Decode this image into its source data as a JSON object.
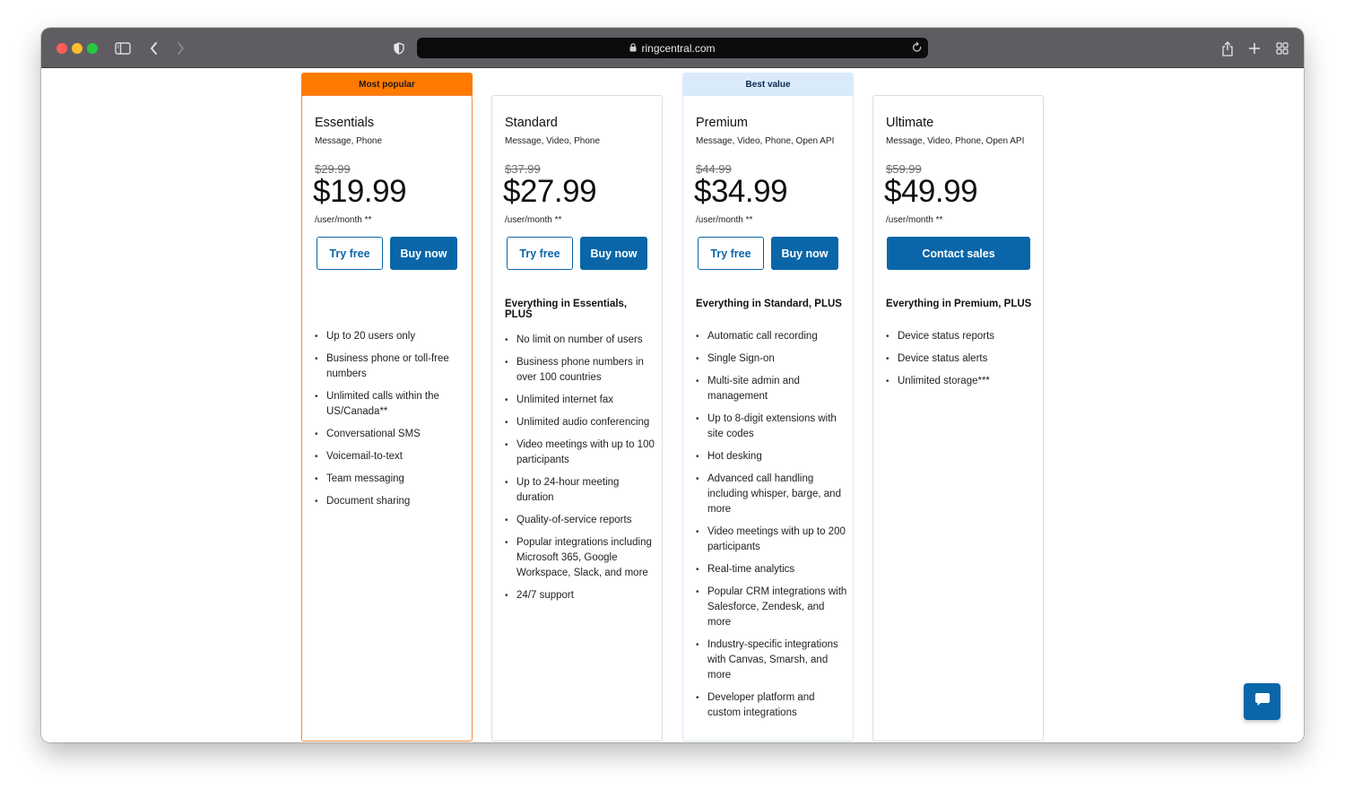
{
  "browser": {
    "url": "ringcentral.com",
    "icons": {
      "sidebar": "sidebar-icon",
      "back": "chevron-left-icon",
      "forward": "chevron-right-icon",
      "privacy": "shield-icon",
      "lock": "lock-icon",
      "reload": "reload-icon",
      "share": "share-icon",
      "new_tab": "plus-icon",
      "tabs": "tab-grid-icon"
    }
  },
  "colors": {
    "brand_blue": "#0a66a8",
    "popular_orange": "#ff7a00",
    "best_value_blue": "#d9eafb"
  },
  "plans": [
    {
      "ribbon": "Most popular",
      "name": "Essentials",
      "channels": "Message, Phone",
      "old_price": "$29.99",
      "price": "$19.99",
      "per": "/user/month **",
      "try_label": "Try free",
      "buy_label": "Buy now",
      "section_title": "",
      "features": [
        "Up to 20 users only",
        "Business phone or toll-free numbers",
        "Unlimited calls within the US/Canada**",
        "Conversational SMS",
        "Voicemail-to-text",
        "Team messaging",
        "Document sharing"
      ]
    },
    {
      "ribbon": "",
      "name": "Standard",
      "channels": "Message, Video, Phone",
      "old_price": "$37.99",
      "price": "$27.99",
      "per": "/user/month **",
      "try_label": "Try free",
      "buy_label": "Buy now",
      "section_title": "Everything in Essentials, PLUS",
      "features": [
        "No limit on number of users",
        "Business phone numbers in over 100 countries",
        "Unlimited internet fax",
        "Unlimited audio conferencing",
        "Video meetings with up to 100 participants",
        "Up to 24-hour meeting duration",
        "Quality-of-service reports",
        "Popular integrations including Microsoft 365, Google Workspace, Slack, and more",
        "24/7 support"
      ]
    },
    {
      "ribbon": "Best value",
      "name": "Premium",
      "channels": "Message, Video, Phone, Open API",
      "old_price": "$44.99",
      "price": "$34.99",
      "per": "/user/month **",
      "try_label": "Try free",
      "buy_label": "Buy now",
      "section_title": "Everything in Standard, PLUS",
      "features": [
        "Automatic call recording",
        "Single Sign-on",
        "Multi-site admin and management",
        "Up to 8-digit extensions with site codes",
        "Hot desking",
        "Advanced call handling including whisper, barge, and more",
        "Video meetings with up to 200 participants",
        "Real-time analytics",
        "Popular CRM integrations with Salesforce, Zendesk, and more",
        "Industry-specific integrations with Canvas, Smarsh, and more",
        "Developer platform and custom integrations"
      ]
    },
    {
      "ribbon": "",
      "name": "Ultimate",
      "channels": "Message, Video, Phone, Open API",
      "old_price": "$59.99",
      "price": "$49.99",
      "per": "/user/month **",
      "contact_label": "Contact sales",
      "section_title": "Everything in Premium, PLUS",
      "features": [
        "Device status reports",
        "Device status alerts",
        "Unlimited storage***"
      ]
    }
  ],
  "chat": {
    "icon": "chat-bubble-icon"
  }
}
